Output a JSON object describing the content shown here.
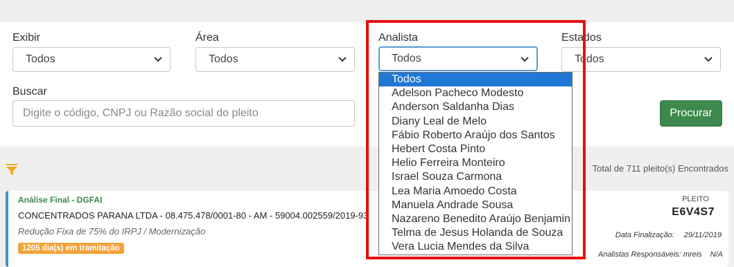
{
  "filters": {
    "exibir": {
      "label": "Exibir",
      "value": "Todos"
    },
    "area": {
      "label": "Área",
      "value": "Todos"
    },
    "analista": {
      "label": "Analista",
      "value": "Todos"
    },
    "estados": {
      "label": "Estados",
      "value": "Todos"
    },
    "buscar": {
      "label": "Buscar",
      "placeholder": "Digite o código, CNPJ ou Razão social do pleito"
    },
    "procurar_label": "Procurar"
  },
  "analista_options": [
    "Todos",
    "Adelson Pacheco Modesto",
    "Anderson Saldanha Dias",
    "Diany Leal de Melo",
    "Fábio Roberto Araújo dos Santos",
    "Hebert Costa Pinto",
    "Helio Ferreira Monteiro",
    "Israel Souza Carmona",
    "Lea Maria Amoedo Costa",
    "Manuela Andrade Sousa",
    "Nazareno Benedito Araújo Benjamin",
    "Telma de Jesus Holanda de Souza",
    "Vera Lucia Mendes da Silva"
  ],
  "results": {
    "total_text": "Total de 711 pleito(s) Encontrados"
  },
  "card": {
    "status": "Análise Final - DGFAI",
    "company_line": "CONCENTRADOS PARANA LTDA - 08.475.478/0001-80 - AM - 59004.002559/2019-93",
    "description": "Redução Fixa de 75% do IRPJ / Modernização",
    "days_badge": "1205 dia(s) em tramitação",
    "pleito_label": "PLEITO",
    "pleito_code": "E6V4S7",
    "finalizacao_label": "Data Finalização:",
    "finalizacao_value": "29/11/2019",
    "responsaveis_label": "Analistas Responsáveis:",
    "responsaveis_value": "mreis",
    "responsaveis_extra": "N/A"
  },
  "colors": {
    "accent_green": "#3e8a4e",
    "highlight_red": "#e80e0e",
    "selected_blue": "#1f77d6",
    "badge_orange": "#f4a23a"
  },
  "icons": {
    "filter": "funnel-icon",
    "select": "chevron-down-icon"
  }
}
